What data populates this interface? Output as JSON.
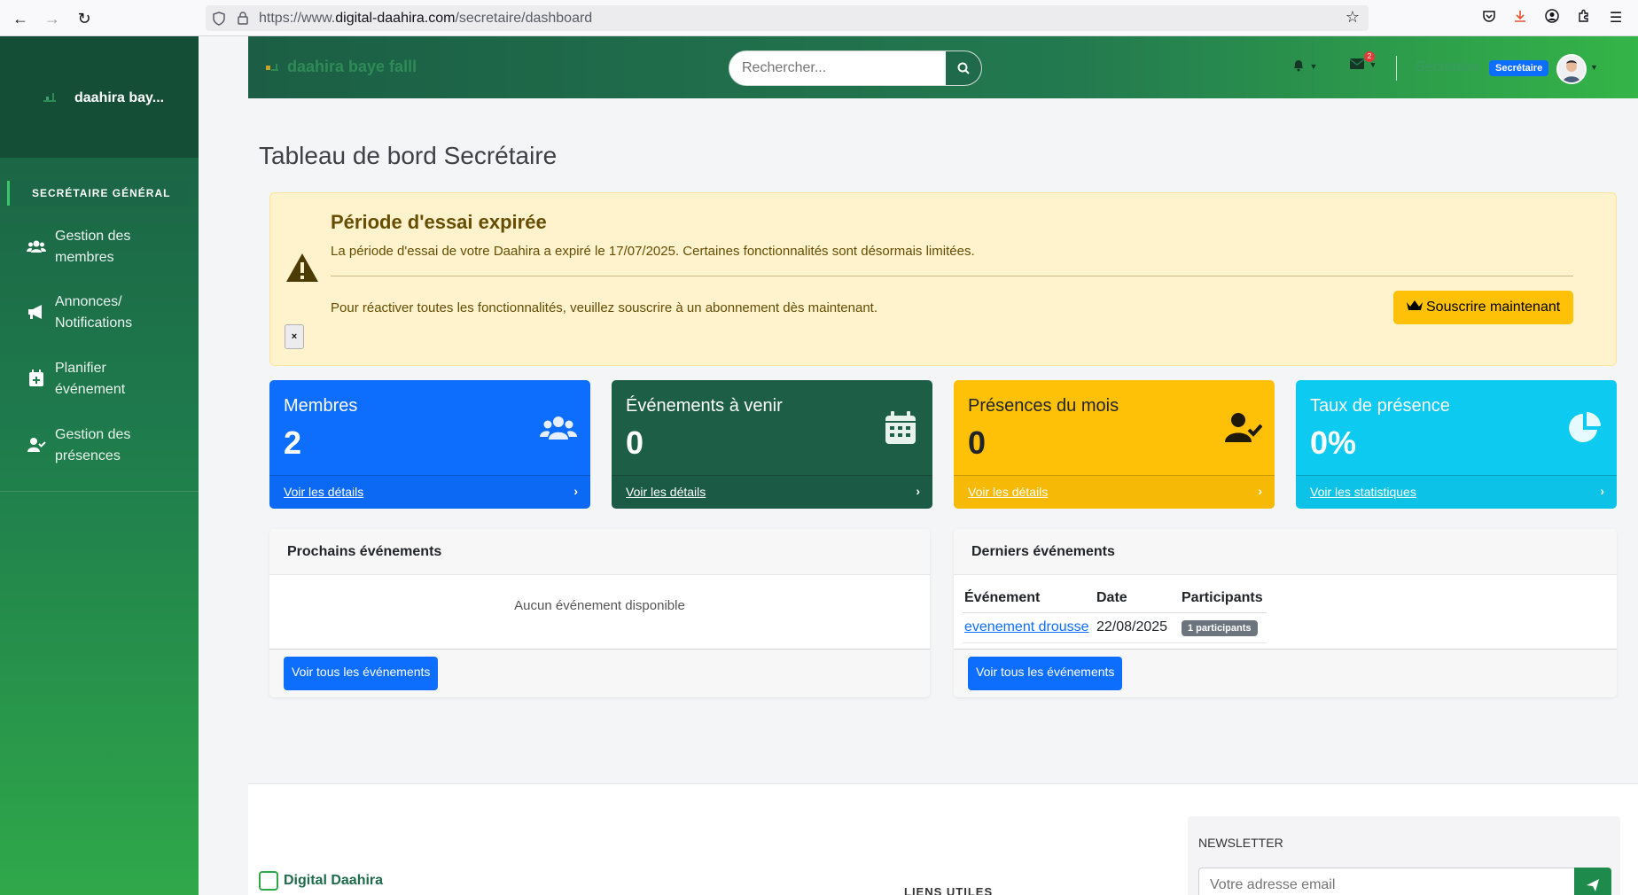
{
  "browser": {
    "url_prefix": "https://www.",
    "url_domain": "digital-daahira.com",
    "url_path": "/secretaire/dashboard",
    "download_badge": ""
  },
  "sidebar": {
    "brand": "daahira bay...",
    "role_label": "SECRÉTAIRE GÉNÉRAL",
    "items": [
      {
        "label": "Gestion des membres",
        "icon": "users-icon"
      },
      {
        "label": "Annonces/ Notifications",
        "icon": "megaphone-icon"
      },
      {
        "label": "Planifier événement",
        "icon": "calendar-plus-icon"
      },
      {
        "label": "Gestion des présences",
        "icon": "user-check-icon"
      }
    ]
  },
  "topbar": {
    "brand": "daahira baye falll",
    "search_placeholder": "Rechercher...",
    "messages_badge": "2",
    "user_name": "Secretaire",
    "user_role": "Secrétaire"
  },
  "main": {
    "title": "Tableau de bord Secrétaire",
    "alert": {
      "title": "Période d'essai expirée",
      "message": "La période d'essai de votre Daahira a expiré le 17/07/2025. Certaines fonctionnalités sont désormais limitées.",
      "message2": "Pour réactiver toutes les fonctionnalités, veuillez souscrire à un abonnement dès maintenant.",
      "button": "Souscrire maintenant",
      "close": "×"
    },
    "cards": [
      {
        "title": "Membres",
        "value": "2",
        "link": "Voir les détails",
        "color": "#0d6efd"
      },
      {
        "title": "Événements à venir",
        "value": "0",
        "link": "Voir les détails",
        "color": "#1d5e47"
      },
      {
        "title": "Présences du mois",
        "value": "0",
        "link": "Voir les détails",
        "color": "#ffc107"
      },
      {
        "title": "Taux de présence",
        "value": "0%",
        "link": "Voir les statistiques",
        "color": "#0dcaf0"
      }
    ],
    "upcoming": {
      "title": "Prochains événements",
      "empty": "Aucun événement disponible",
      "button": "Voir tous les événements"
    },
    "recent": {
      "title": "Derniers événements",
      "columns": [
        "Événement",
        "Date",
        "Participants"
      ],
      "rows": [
        {
          "event": "evenement drousse",
          "date": "22/08/2025",
          "participants": "1 participants"
        }
      ],
      "button": "Voir tous les événements"
    }
  },
  "footer": {
    "brand": "Digital Daahira",
    "liens_title": "LIENS UTILES",
    "newsletter_title": "NEWSLETTER",
    "email_placeholder": "Votre adresse email"
  }
}
